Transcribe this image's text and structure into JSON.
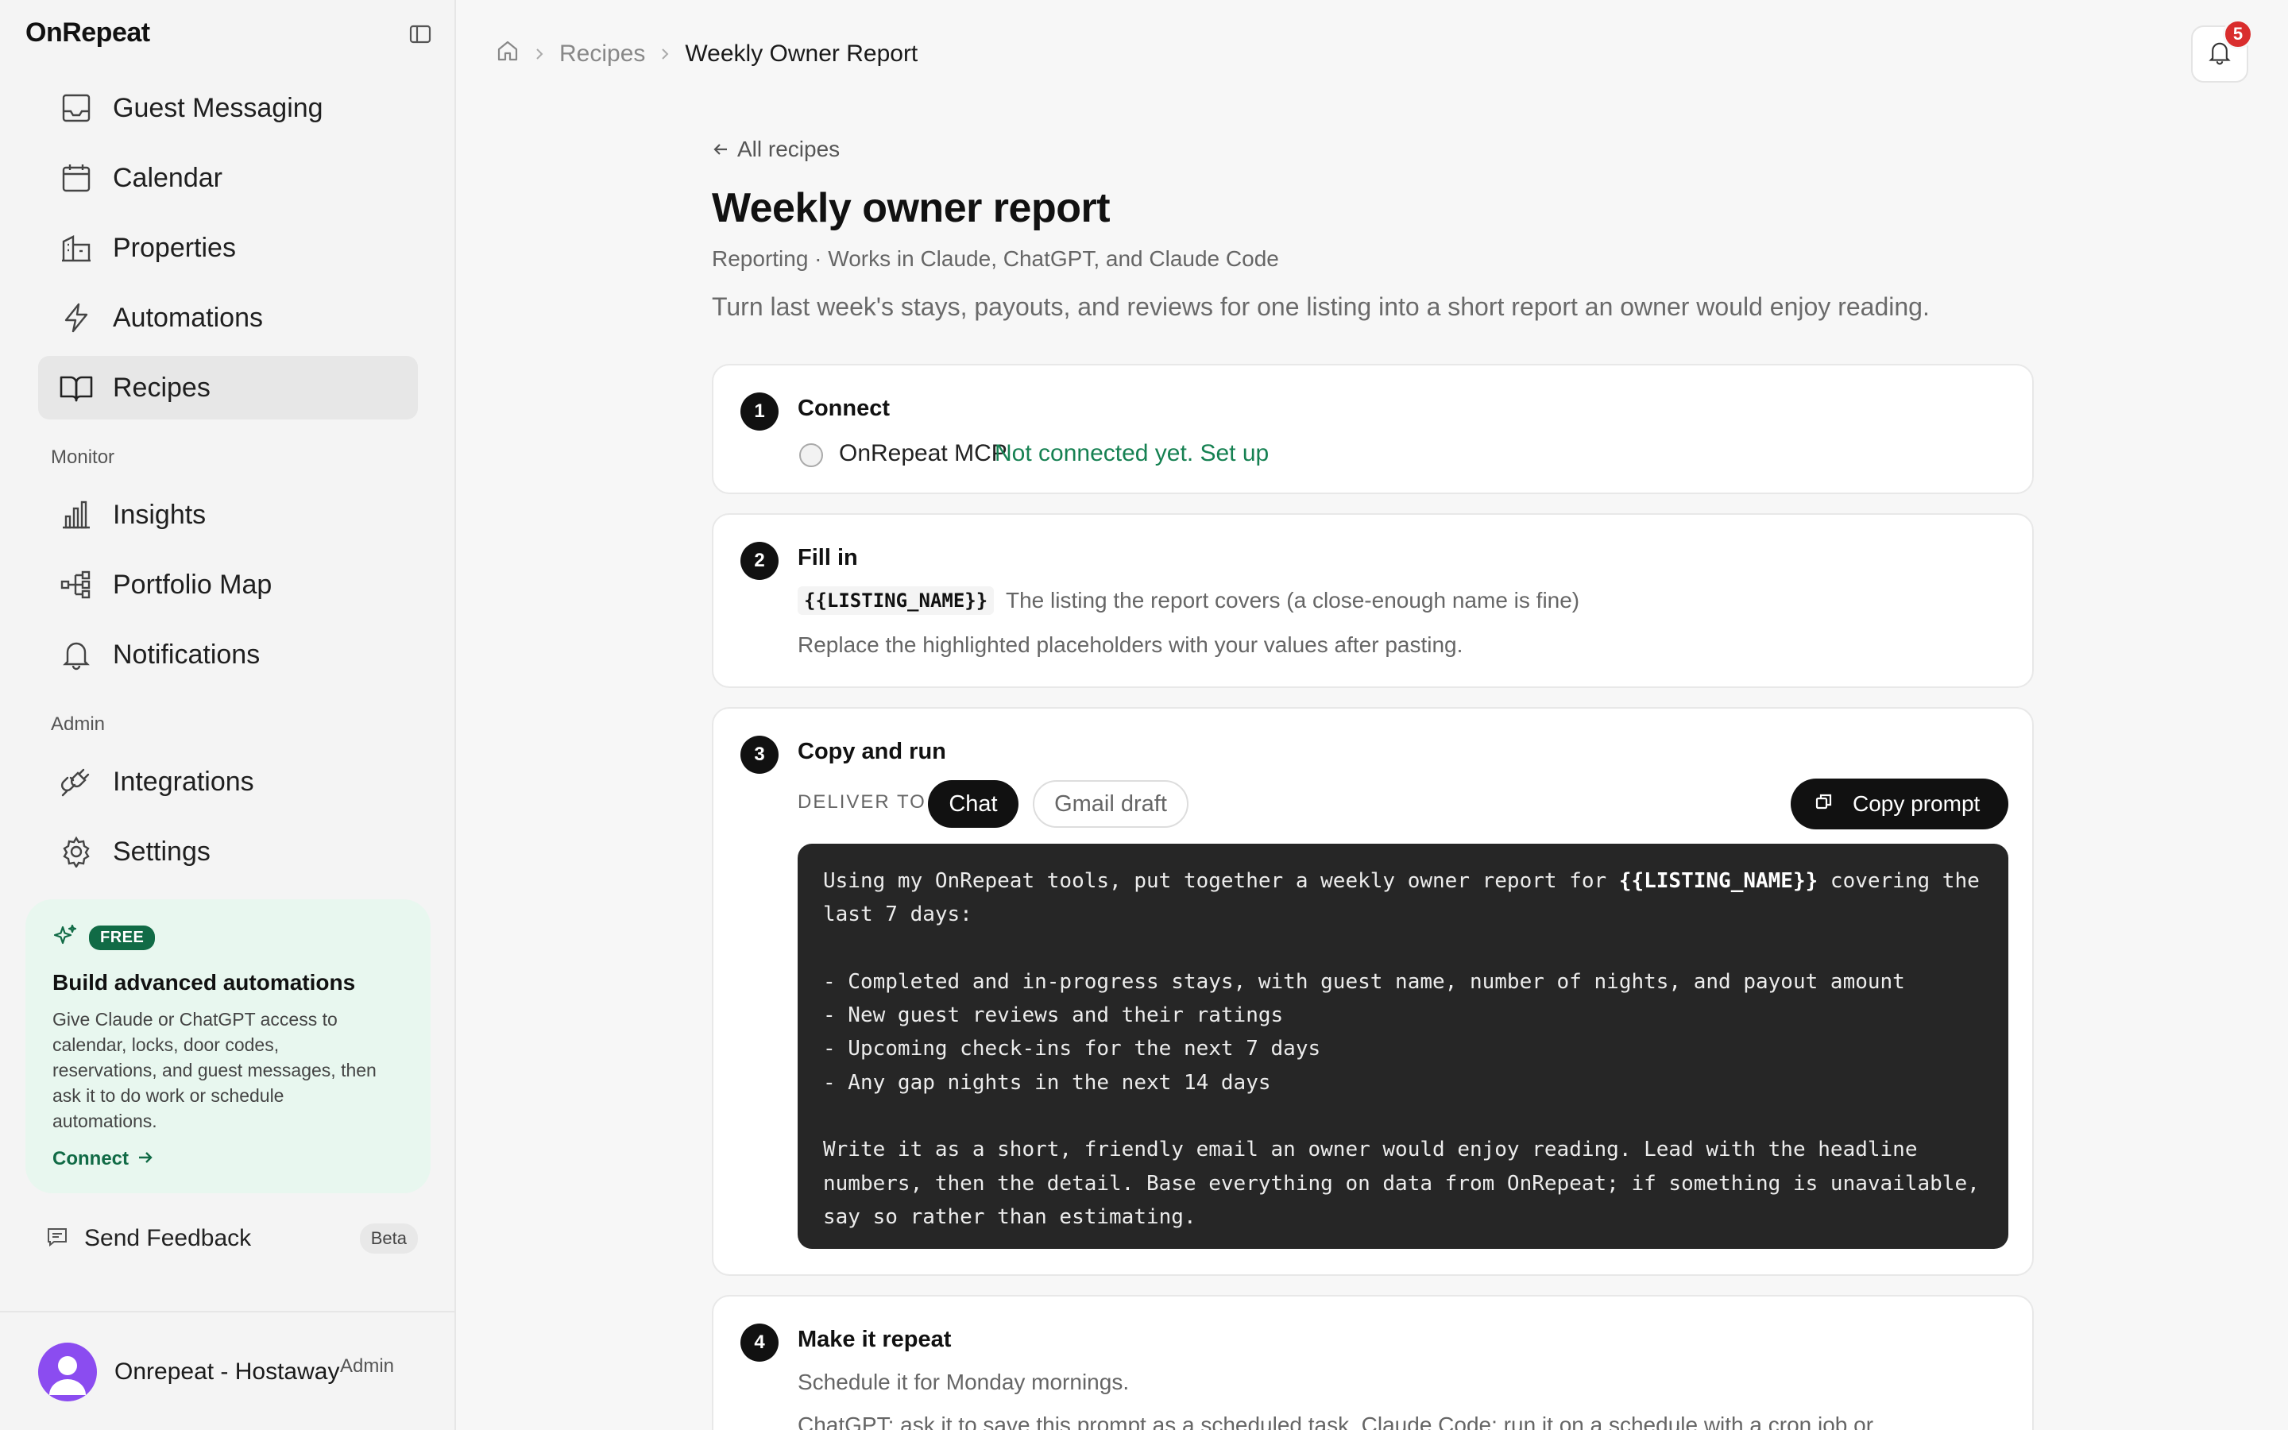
{
  "app": {
    "name": "OnRepeat"
  },
  "sidebar": {
    "main_items": [
      {
        "label": "Guest Messaging",
        "icon": "inbox-icon"
      },
      {
        "label": "Calendar",
        "icon": "calendar-icon"
      },
      {
        "label": "Properties",
        "icon": "building-icon"
      },
      {
        "label": "Automations",
        "icon": "lightning-icon"
      },
      {
        "label": "Recipes",
        "icon": "book-icon",
        "active": true
      }
    ],
    "monitor_label": "Monitor",
    "monitor_items": [
      {
        "label": "Insights",
        "icon": "bar-chart-icon"
      },
      {
        "label": "Portfolio Map",
        "icon": "hierarchy-icon"
      },
      {
        "label": "Notifications",
        "icon": "bell-icon"
      }
    ],
    "admin_label": "Admin",
    "admin_items": [
      {
        "label": "Integrations",
        "icon": "plug-icon"
      },
      {
        "label": "Settings",
        "icon": "gear-icon"
      }
    ],
    "promo": {
      "badge": "FREE",
      "title": "Build advanced automations",
      "body": "Give Claude or ChatGPT access to calendar, locks, door codes, reservations, and guest messages, then ask it to do work or schedule automations.",
      "cta": "Connect"
    },
    "feedback": {
      "label": "Send Feedback",
      "badge": "Beta"
    },
    "user": {
      "name": "Onrepeat - Hostaway",
      "role": "Admin"
    }
  },
  "breadcrumb": {
    "parent": "Recipes",
    "current": "Weekly Owner Report"
  },
  "notifications": {
    "count": "5"
  },
  "recipe": {
    "back_label": "All recipes",
    "title": "Weekly owner report",
    "meta": "Reporting · Works in Claude, ChatGPT, and Claude Code",
    "description": "Turn last week's stays, payouts, and reviews for one listing into a short report an owner would enjoy reading.",
    "steps": {
      "connect": {
        "number": "1",
        "title": "Connect",
        "service": "OnRepeat MCP",
        "status": "Not connected yet. Set up"
      },
      "fill": {
        "number": "2",
        "title": "Fill in",
        "placeholder": "{{LISTING_NAME}}",
        "placeholder_desc": "The listing the report covers (a close-enough name is fine)",
        "note": "Replace the highlighted placeholders with your values after pasting."
      },
      "copy": {
        "number": "3",
        "title": "Copy and run",
        "deliver_label": "DELIVER TO",
        "options": [
          "Chat",
          "Gmail draft"
        ],
        "selected": "Chat",
        "copy_label": "Copy prompt",
        "prompt": {
          "l1a": "Using my OnRepeat tools, put together a weekly owner report for ",
          "l1ph": "{{LISTING_NAME}}",
          "l1b": " covering the",
          "l2": "last 7 days:",
          "l3": "",
          "l4": "- Completed and in-progress stays, with guest name, number of nights, and payout amount",
          "l5": "- New guest reviews and their ratings",
          "l6": "- Upcoming check-ins for the next 7 days",
          "l7": "- Any gap nights in the next 14 days",
          "l8": "",
          "l9": "Write it as a short, friendly email an owner would enjoy reading. Lead with the headline",
          "l10": "numbers, then the detail. Base everything on data from OnRepeat; if something is unavailable,",
          "l11": "say so rather than estimating."
        }
      },
      "repeat": {
        "number": "4",
        "title": "Make it repeat",
        "line1": "Schedule it for Monday mornings.",
        "line2": "ChatGPT: ask it to save this prompt as a scheduled task. Claude Code: run it on a schedule with a cron job or"
      }
    }
  },
  "colors": {
    "accent_green": "#168152",
    "badge_red": "#d92d2d",
    "dark": "#111111",
    "avatar_purple": "#8b4cf0"
  }
}
